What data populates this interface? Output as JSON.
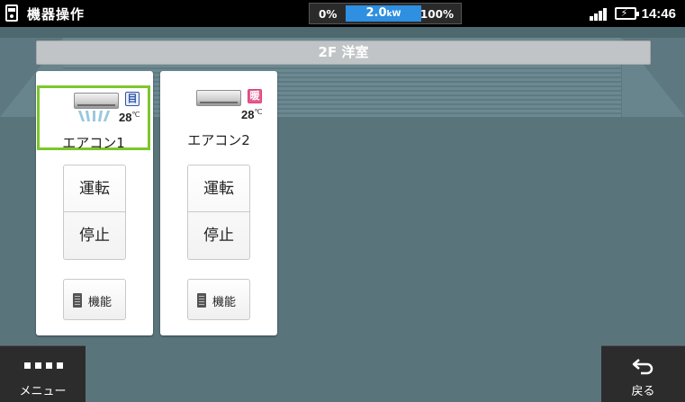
{
  "statusbar": {
    "title": "機器操作",
    "power": {
      "min": "0%",
      "value": "2.0",
      "unit": "kW",
      "max": "100%"
    },
    "time": "14:46"
  },
  "room": {
    "name": "2F 洋室"
  },
  "devices": [
    {
      "name": "エアコン1",
      "mode": "目",
      "mode_color": "#2e55a8",
      "temperature": "28",
      "temp_unit": "℃",
      "selected": true,
      "run_label": "運転",
      "stop_label": "停止",
      "function_label": "機能"
    },
    {
      "name": "エアコン2",
      "mode": "暖",
      "mode_color": "#e45b8e",
      "temperature": "28",
      "temp_unit": "℃",
      "selected": false,
      "run_label": "運転",
      "stop_label": "停止",
      "function_label": "機能"
    }
  ],
  "bottom": {
    "menu_label": "メニュー",
    "back_label": "戻る"
  },
  "icons": {
    "app": "home-device-icon",
    "signal": "signal-icon",
    "battery": "battery-charging-icon",
    "menu": "menu-dots-icon",
    "back": "back-arrow-icon",
    "remote": "remote-control-icon",
    "aircon": "air-conditioner-icon"
  },
  "colors": {
    "accent_power": "#2f8fe0",
    "selected_border": "#7dc72b",
    "room_background": "#5d7880"
  }
}
